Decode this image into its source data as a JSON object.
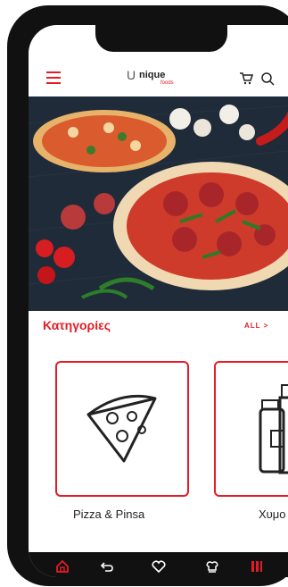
{
  "header": {
    "logo_mark": "U",
    "logo_text": "nique",
    "logo_sub": "foods"
  },
  "categories": {
    "title": "Κατηγορίες",
    "all_label": "ALL >",
    "items": [
      {
        "label": "Pizza & Pinsa"
      },
      {
        "label": "Χυμο"
      }
    ]
  },
  "colors": {
    "accent": "#e31c26",
    "nav_bg": "#111111"
  }
}
